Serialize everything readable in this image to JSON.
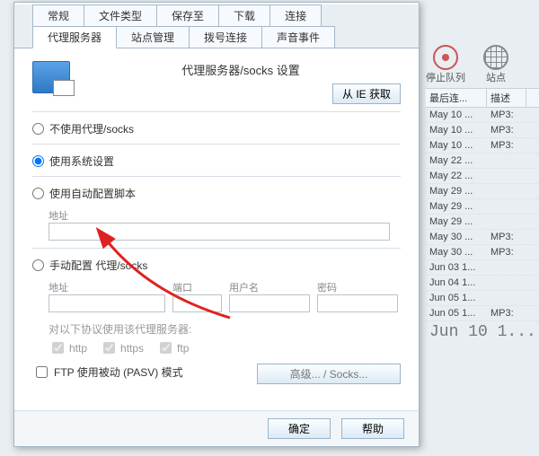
{
  "tabsTop": [
    "常规",
    "文件类型",
    "保存至",
    "下载",
    "连接"
  ],
  "tabsSecond": [
    "代理服务器",
    "站点管理",
    "拨号连接",
    "声音事件"
  ],
  "activeTab": "代理服务器",
  "title": "代理服务器/socks 设置",
  "ieButton": "从 IE 获取",
  "radios": {
    "noProxy": "不使用代理/socks",
    "systemSettings": "使用系统设置",
    "autoScript": "使用自动配置脚本",
    "manual": "手动配置 代理/socks"
  },
  "selectedRadio": "systemSettings",
  "labels": {
    "address": "地址",
    "port": "端口",
    "username": "用户名",
    "password": "密码",
    "protocolsHint": "对以下协议使用该代理服务器:"
  },
  "protocols": {
    "http": "http",
    "https": "https",
    "ftp": "ftp"
  },
  "advancedButton": "高级... / Socks...",
  "ftpPassive": "FTP 使用被动 (PASV) 模式",
  "okButton": "确定",
  "helpButton": "帮助",
  "rightIcons": {
    "stop": "停止队列",
    "site": "站点"
  },
  "listHeaders": {
    "lastConnect": "最后连...",
    "desc": "描述"
  },
  "rows": [
    {
      "date": "May 10 ...",
      "desc": "MP3:"
    },
    {
      "date": "May 10 ...",
      "desc": "MP3:"
    },
    {
      "date": "May 10 ...",
      "desc": "MP3:"
    },
    {
      "date": "May 22 ...",
      "desc": ""
    },
    {
      "date": "May 22 ...",
      "desc": ""
    },
    {
      "date": "May 29 ...",
      "desc": ""
    },
    {
      "date": "May 29 ...",
      "desc": ""
    },
    {
      "date": "May 29 ...",
      "desc": ""
    },
    {
      "date": "May 30 ...",
      "desc": "MP3:"
    },
    {
      "date": "May 30 ...",
      "desc": "MP3:"
    },
    {
      "date": "Jun 03 1...",
      "desc": ""
    },
    {
      "date": "Jun 04 1...",
      "desc": ""
    },
    {
      "date": "Jun 05 1...",
      "desc": ""
    },
    {
      "date": "Jun 05 1...",
      "desc": "MP3:"
    }
  ],
  "barcode": "Jun 10 1..."
}
